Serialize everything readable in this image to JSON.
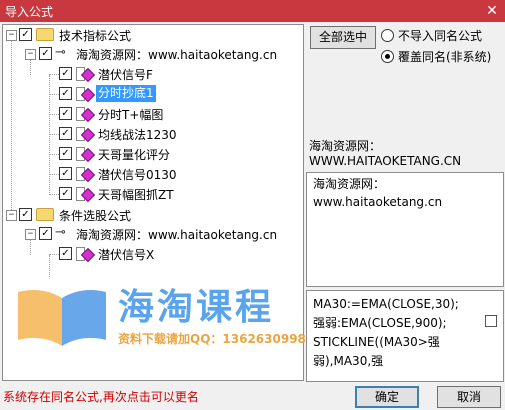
{
  "window": {
    "title": "导入公式",
    "close_glyph": "✕"
  },
  "tree": {
    "group1": {
      "label": "技术指标公式"
    },
    "source1": {
      "label": "海淘资源网：www.haitaoketang.cn"
    },
    "items1": [
      {
        "label": "潜伏信号F"
      },
      {
        "label": "分时抄底1"
      },
      {
        "label": "分时T+幅图"
      },
      {
        "label": "均线战法1230"
      },
      {
        "label": "天哥量化评分"
      },
      {
        "label": "潜伏信号0130"
      },
      {
        "label": "天哥幅图抓ZT"
      }
    ],
    "group2": {
      "label": "条件选股公式"
    },
    "source2": {
      "label": "海淘资源网：www.haitaoketang.cn"
    },
    "items2": [
      {
        "label": "潜伏信号X"
      }
    ]
  },
  "watermark": {
    "title": "海淘课程",
    "subtitle": "资料下载请加QQ：1362630998"
  },
  "options": {
    "select_all_label": "全部选中",
    "no_import_label": "不导入同名公式",
    "overwrite_label": "覆盖同名(非系统)",
    "selected": "overwrite"
  },
  "info": {
    "source_line1": "海淘资源网：",
    "source_line2": "WWW.HAITAOKETANG.CN",
    "desc_line1": "海淘资源网：",
    "desc_line2": "www.haitaoketang.cn",
    "code_lines": [
      "MA30:=EMA(CLOSE,30);",
      "强弱:EMA(CLOSE,900);",
      "STICKLINE((MA30>强",
      "弱),MA30,强"
    ]
  },
  "status": "系统存在同名公式,再次点击可以更名",
  "buttons": {
    "ok": "确定",
    "cancel": "取消"
  },
  "colors": {
    "titlebar": "#c8383e",
    "selection": "#3399ff",
    "status": "#d00000"
  }
}
